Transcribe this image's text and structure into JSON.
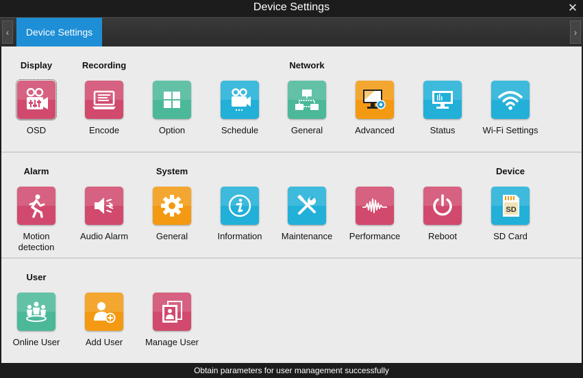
{
  "window": {
    "title": "Device Settings"
  },
  "tab": {
    "label": "Device Settings"
  },
  "colors": {
    "pink": "#d14a6e",
    "teal": "#4cb89a",
    "cyan": "#22b0d8",
    "orange": "#f39a12",
    "tab": "#1e8fd6"
  },
  "categories": {
    "display": "Display",
    "recording": "Recording",
    "network": "Network",
    "alarm": "Alarm",
    "system": "System",
    "device": "Device",
    "user": "User"
  },
  "items": {
    "osd": {
      "label": "OSD",
      "icon": "osd-icon"
    },
    "encode": {
      "label": "Encode",
      "icon": "encode-icon"
    },
    "option": {
      "label": "Option",
      "icon": "grid-icon"
    },
    "schedule": {
      "label": "Schedule",
      "icon": "camera-schedule-icon"
    },
    "net_general": {
      "label": "General",
      "icon": "network-icon"
    },
    "advanced": {
      "label": "Advanced",
      "icon": "monitor-gear-icon"
    },
    "status": {
      "label": "Status",
      "icon": "monitor-status-icon"
    },
    "wifi": {
      "label": "Wi-Fi Settings",
      "icon": "wifi-icon"
    },
    "motion": {
      "label_line1": "Motion",
      "label_line2": "detection",
      "icon": "running-man-icon"
    },
    "audio_alarm": {
      "label": "Audio Alarm",
      "icon": "speaker-alarm-icon"
    },
    "sys_general": {
      "label": "General",
      "icon": "gear-icon"
    },
    "information": {
      "label": "Information",
      "icon": "info-icon"
    },
    "maintenance": {
      "label": "Maintenance",
      "icon": "tools-icon"
    },
    "performance": {
      "label": "Performance",
      "icon": "waveform-icon"
    },
    "reboot": {
      "label": "Reboot",
      "icon": "power-icon"
    },
    "sdcard": {
      "label": "SD Card",
      "icon": "sd-card-icon",
      "text": "SD"
    },
    "online_user": {
      "label": "Online User",
      "icon": "users-icon"
    },
    "add_user": {
      "label": "Add User",
      "icon": "add-user-icon"
    },
    "manage_user": {
      "label": "Manage User",
      "icon": "manage-user-icon"
    }
  },
  "status": {
    "message": "Obtain parameters for user management successfully"
  }
}
